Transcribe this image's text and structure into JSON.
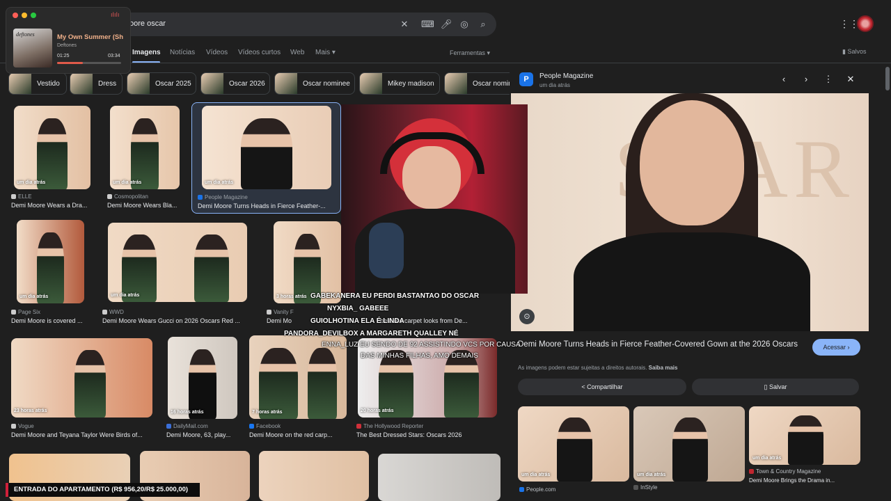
{
  "search": {
    "query": "oore oscar"
  },
  "tabs": [
    {
      "label": "Imagens",
      "active": true
    },
    {
      "label": "Notícias"
    },
    {
      "label": "Vídeos"
    },
    {
      "label": "Vídeos curtos"
    },
    {
      "label": "Web"
    },
    {
      "label": "Mais"
    }
  ],
  "tools_label": "Ferramentas",
  "saved_label": "Salvos",
  "chips": [
    "Vestido",
    "Dress",
    "Oscar 2025",
    "Oscar 2026",
    "Oscar nominee",
    "Mikey madison",
    "Oscar nomina"
  ],
  "results": [
    {
      "source": "ELLE",
      "caption": "Demi Moore Wears a Dra...",
      "time": "um dia atrás"
    },
    {
      "source": "Cosmopolitan",
      "caption": "Demi Moore Wears Bla...",
      "time": "um dia atrás"
    },
    {
      "source": "People Magazine",
      "caption": "Demi Moore Turns Heads in Fierce Feather-...",
      "time": "um dia atrás"
    },
    {
      "source": "Page Six",
      "caption": "Demi Moore is covered ...",
      "time": "um dia atrás"
    },
    {
      "source": "WWD",
      "caption": "Demi Moore Wears Gucci on 2026 Oscars Red ...",
      "time": "um dia atrás"
    },
    {
      "source": "Vanity F",
      "caption": "Demi Mo",
      "time": "3 horas atrás"
    },
    {
      "source": "",
      "caption": "best red carpet looks from De...",
      "time": ""
    },
    {
      "source": "Vogue",
      "caption": "Demi Moore and Teyana Taylor Were Birds of...",
      "time": "23 horas atrás"
    },
    {
      "source": "DailyMail.com",
      "caption": "Demi Moore, 63, play...",
      "time": "16 horas atrás"
    },
    {
      "source": "Facebook",
      "caption": "Demi Moore on the red carp...",
      "time": "7 horas atrás"
    },
    {
      "source": "The Hollywood Reporter",
      "caption": "The Best Dressed Stars: Oscars 2026",
      "time": "20 horas atrás"
    }
  ],
  "panel": {
    "source": "People Magazine",
    "time": "um dia atrás",
    "logo_letter": "P",
    "title": "Demi Moore Turns Heads in Fierce Feather-Covered Gown at the 2026 Oscars",
    "visit_label": "Acessar",
    "rights_text": "As imagens podem estar sujeitas a direitos autorais.",
    "learn_more": "Saiba mais",
    "share_label": "Compartilhar",
    "save_label": "Salvar",
    "related": [
      {
        "time": "um dia atrás",
        "source": "People.com",
        "caption": ""
      },
      {
        "time": "um dia atrás",
        "source": "InStyle",
        "caption": ""
      },
      {
        "time": "um dia atrás",
        "source": "Town & Country Magazine",
        "caption": "Demi Moore Brings the Drama in..."
      }
    ]
  },
  "player": {
    "song": "My Own Summer (Sh",
    "artist": "Deftones",
    "album_text": "deftones",
    "elapsed": "01:25",
    "duration": "03:34",
    "progress": 0.4
  },
  "chat": [
    {
      "text": "GABEKANERA  EU PERDI BASTANTAO DO OSCAR"
    },
    {
      "text": "NYXBIA_  GABEEE"
    },
    {
      "text": "GUIOLHOTINA  ELA É LINDA"
    },
    {
      "text": "PANDORA_DEVILBOX  A MARGARETH QUALLEY NÉ"
    },
    {
      "text": "ENNA_LUZ  EU SENDO DE 92 ASSISTINDO VCS POR CAUSA"
    },
    {
      "text": "DAS MINHAS FILHAS, AMO DEMAIS"
    }
  ],
  "ticker": "ENTRADA DO APARTAMENTO (R$ 956,20/R$ 25.000,00)",
  "colors": {
    "accent": "#8ab4f8",
    "background": "#1f1f1f",
    "ticker_red": "#d0203a"
  }
}
